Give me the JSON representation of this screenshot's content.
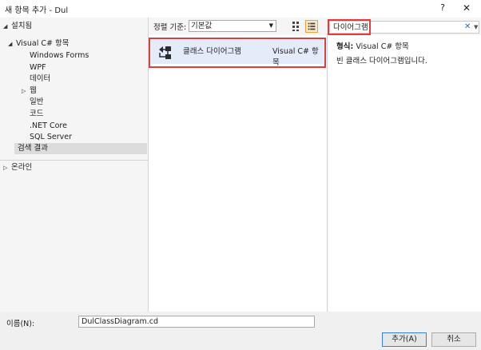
{
  "window": {
    "title": "새 항목 추가 - Dul",
    "help_label": "?",
    "close_label": "✕"
  },
  "tree": {
    "installed_label": "설치됨",
    "items": [
      {
        "label": "Visual C# 항목"
      },
      {
        "label": "Windows Forms"
      },
      {
        "label": "WPF"
      },
      {
        "label": "데이터"
      },
      {
        "label": "웹"
      },
      {
        "label": "일반"
      },
      {
        "label": "코드"
      },
      {
        "label": ".NET Core"
      },
      {
        "label": "SQL Server"
      },
      {
        "label": "검색 결과"
      }
    ],
    "online_label": "온라인"
  },
  "toolbar": {
    "sort_label": "정렬 기준:",
    "sort_value": "기본값"
  },
  "search": {
    "value": "다이어그램",
    "clear_label": "✕"
  },
  "templates": [
    {
      "name": "클래스 다이어그램",
      "type": "Visual C# 항목",
      "icon": "class-diagram-icon"
    }
  ],
  "details": {
    "type_label": "형식:",
    "type_value": "Visual C# 항목",
    "description": "빈 클래스 다이어그램입니다."
  },
  "footer": {
    "name_label": "이름(N):",
    "name_value": "DulClassDiagram.cd",
    "add_label": "추가(A)",
    "cancel_label": "취소"
  },
  "colors": {
    "highlight_border": "#e03c3c",
    "selection_bg": "#e5ecf9",
    "accent_blue": "#3c7fd8"
  }
}
